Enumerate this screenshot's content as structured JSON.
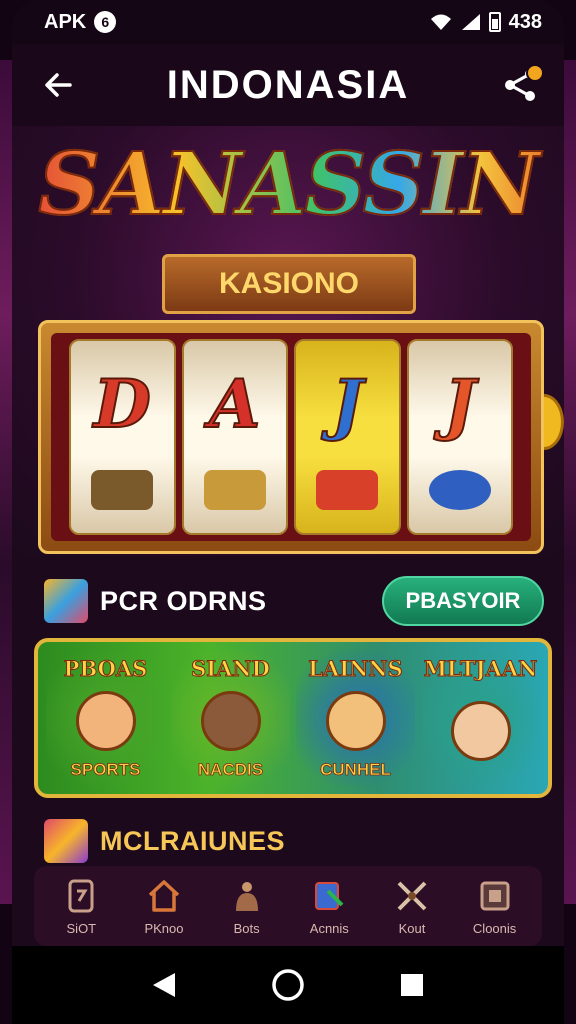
{
  "status_bar": {
    "carrier": "APK",
    "badge": "6",
    "time": "438"
  },
  "header": {
    "title": "INDONASIA",
    "back_icon": "arrow-left-icon",
    "share_icon": "share-icon"
  },
  "hero": {
    "logo": "SANASSIN",
    "ribbon": "KASIONO",
    "reels": [
      {
        "letter": "D",
        "color": "#d83a2a",
        "style": "cream"
      },
      {
        "letter": "A",
        "color": "#d6302a",
        "style": "cream"
      },
      {
        "letter": "J",
        "color": "#2f6fd0",
        "style": "yellow"
      },
      {
        "letter": "J",
        "color": "#e4552a",
        "style": "cream"
      }
    ]
  },
  "section_primary": {
    "title": "PCR ODRNS",
    "button_label": "PBASYOIR"
  },
  "games": [
    {
      "title": "PBOAS",
      "subtitle": "SPORTS"
    },
    {
      "title": "SIAND",
      "subtitle": "NACDIS"
    },
    {
      "title": "LAINNS",
      "subtitle": "CUNHEL"
    },
    {
      "title": "MLTJAAN",
      "subtitle": ""
    }
  ],
  "section_secondary": {
    "title": "MCLRAIUNES"
  },
  "bottom_nav": [
    {
      "label": "SiOT",
      "icon": "slot-icon"
    },
    {
      "label": "PKnoo",
      "icon": "home-icon"
    },
    {
      "label": "Bots",
      "icon": "bag-icon"
    },
    {
      "label": "Acnnis",
      "icon": "card-icon"
    },
    {
      "label": "Kout",
      "icon": "swords-icon"
    },
    {
      "label": "Cloonis",
      "icon": "box-icon"
    }
  ],
  "colors": {
    "accent_green": "#27b07c",
    "gold": "#f6c656",
    "background": "#1c0a1c"
  }
}
